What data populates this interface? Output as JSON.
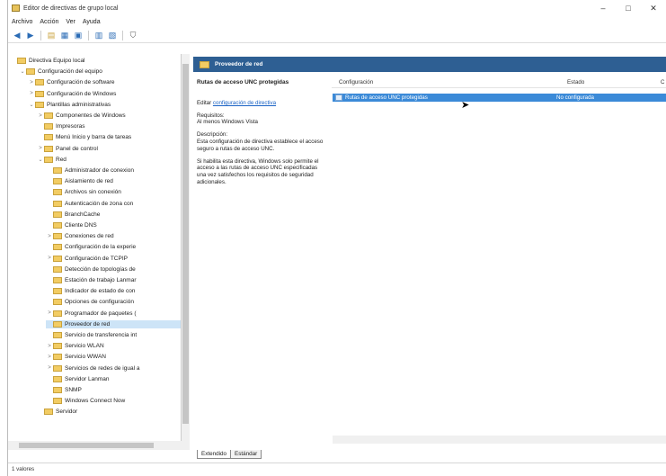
{
  "window": {
    "title": "Editor de directivas de grupo local",
    "min": "–",
    "max": "□",
    "close": "✕"
  },
  "menu": [
    "Archivo",
    "Acción",
    "Ver",
    "Ayuda"
  ],
  "toolbar": {
    "icons": [
      "back-arrow-icon",
      "forward-arrow-icon",
      "up-folder-icon",
      "show-tree-icon",
      "export-icon",
      "properties-icon",
      "help-icon",
      "filter-icon"
    ]
  },
  "tree": [
    {
      "label": "Directiva Equipo local",
      "level": 0,
      "toggle": ""
    },
    {
      "label": "Configuración del equipo",
      "level": 1,
      "toggle": "⌄"
    },
    {
      "label": "Configuración de software",
      "level": 2,
      "toggle": ">"
    },
    {
      "label": "Configuración de Windows",
      "level": 2,
      "toggle": ">"
    },
    {
      "label": "Plantillas administrativas",
      "level": 2,
      "toggle": "⌄"
    },
    {
      "label": "Componentes de Windows",
      "level": 3,
      "toggle": ">"
    },
    {
      "label": "Impresoras",
      "level": 3,
      "toggle": ""
    },
    {
      "label": "Menú Inicio y barra de tareas",
      "level": 3,
      "toggle": ""
    },
    {
      "label": "Panel de control",
      "level": 3,
      "toggle": ">"
    },
    {
      "label": "Red",
      "level": 3,
      "toggle": "⌄"
    },
    {
      "label": "Administrador de conexion",
      "level": 4,
      "toggle": ""
    },
    {
      "label": "Aislamiento de red",
      "level": 4,
      "toggle": ""
    },
    {
      "label": "Archivos sin conexión",
      "level": 4,
      "toggle": ""
    },
    {
      "label": "Autenticación de zona con",
      "level": 4,
      "toggle": ""
    },
    {
      "label": "BranchCache",
      "level": 4,
      "toggle": ""
    },
    {
      "label": "Cliente DNS",
      "level": 4,
      "toggle": ""
    },
    {
      "label": "Conexiones de red",
      "level": 4,
      "toggle": ">"
    },
    {
      "label": "Configuración de la experie",
      "level": 4,
      "toggle": ""
    },
    {
      "label": "Configuración de TCPIP",
      "level": 4,
      "toggle": ">"
    },
    {
      "label": "Detección de topologías de",
      "level": 4,
      "toggle": ""
    },
    {
      "label": "Estación de trabajo Lanmar",
      "level": 4,
      "toggle": ""
    },
    {
      "label": "Indicador de estado de con",
      "level": 4,
      "toggle": ""
    },
    {
      "label": "Opciones de configuración",
      "level": 4,
      "toggle": ""
    },
    {
      "label": "Programador de paquetes (",
      "level": 4,
      "toggle": ">"
    },
    {
      "label": "Proveedor de red",
      "level": 4,
      "toggle": "",
      "selected": true
    },
    {
      "label": "Servicio de transferencia int",
      "level": 4,
      "toggle": ""
    },
    {
      "label": "Servicio WLAN",
      "level": 4,
      "toggle": ">"
    },
    {
      "label": "Servicio WWAN",
      "level": 4,
      "toggle": ">"
    },
    {
      "label": "Servicios de redes de igual a",
      "level": 4,
      "toggle": ">"
    },
    {
      "label": "Servidor Lanman",
      "level": 4,
      "toggle": ""
    },
    {
      "label": "SNMP",
      "level": 4,
      "toggle": ""
    },
    {
      "label": "Windows Connect Now",
      "level": 4,
      "toggle": ""
    },
    {
      "label": "Servidor",
      "level": 3,
      "toggle": ""
    }
  ],
  "pane": {
    "header": "Proveedor de red"
  },
  "description": {
    "title": "Rutas de acceso UNC protegidas",
    "edit_prefix": "Editar",
    "edit_link": "configuración de directiva",
    "req_label": "Requisitos:",
    "req_value": "Al menos Windows Vista",
    "desc_label": "Descripción:",
    "desc_text": "Esta configuración de directiva establece el acceso seguro a rutas de acceso UNC.",
    "extra_text": "Si habilita esta directiva, Windows solo permite el acceso a las rutas de acceso UNC especificadas una vez satisfechos los requisitos de seguridad adicionales."
  },
  "columns": {
    "config": "Configuración",
    "state": "Estado",
    "comment": "C"
  },
  "rows": [
    {
      "name": "Rutas de acceso UNC protegidas",
      "state": "No configurada"
    }
  ],
  "tabs": {
    "extended": "Extendido",
    "standard": "Estándar"
  },
  "status": "1 valores"
}
